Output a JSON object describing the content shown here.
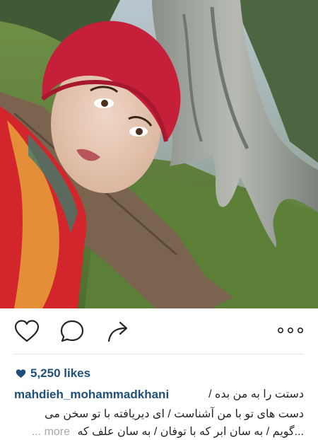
{
  "post": {
    "likes_count": "5,250 likes",
    "username": "mahdieh_mohammadkhani",
    "caption_line1": "دستت را به من بده /",
    "caption_line2": "دست های تو با من آشناست / ای دیریافته با تو سخن می",
    "caption_line3": "گویم / به سان ابر که با توفان / به سان علف که...",
    "more_label": "... more"
  },
  "icons": {
    "like": "heart-icon",
    "comment": "comment-bubble-icon",
    "share": "share-arrow-icon",
    "options": "more-options-icon"
  },
  "colors": {
    "username": "#1f4f7a",
    "likes": "#1f4f7a",
    "more": "#a8a8a8"
  }
}
